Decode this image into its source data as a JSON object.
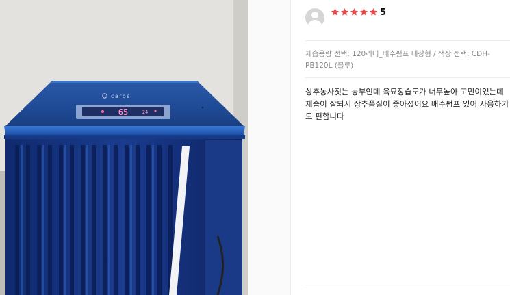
{
  "review": {
    "rating": "5",
    "stars_filled": 5,
    "star_color": "#e8494a",
    "option_label": "제습용량 선택: 120리터_배수펌프 내장형 / 색상 선택: CDH-PB120L (블루)",
    "content": "상추농사짓는 농부인데 육묘장습도가 너무높아 고민이었는데 제습이 잘되서 상추품질이 좋아졌어요 배수펌프 있어 사용하기도 편합니다"
  },
  "photo": {
    "brand": "caros",
    "display_value": "65",
    "display_small": "24"
  },
  "icons": {
    "avatar": "user-avatar-icon",
    "star": "star-icon"
  }
}
